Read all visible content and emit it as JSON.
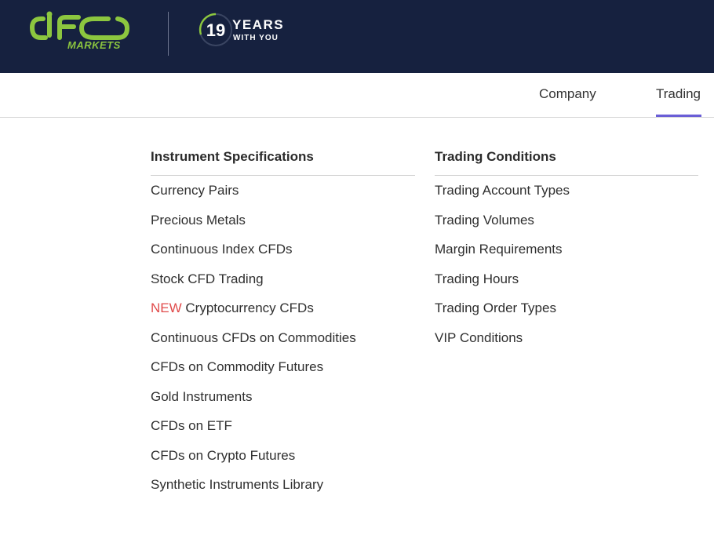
{
  "header": {
    "logo_text": "IFC",
    "logo_subtext": "MARKETS",
    "years_number": "19",
    "years_label": "YEARS",
    "years_sublabel": "WITH YOU",
    "colors": {
      "background": "#16213f",
      "brand_green": "#8cc63f"
    }
  },
  "nav": {
    "items": [
      {
        "label": "Company"
      },
      {
        "label": "Trading",
        "active": true
      }
    ],
    "active_color": "#6a5ed6"
  },
  "menu": {
    "instrument_specifications": {
      "title": "Instrument Specifications",
      "items": [
        {
          "label": "Currency Pairs"
        },
        {
          "label": "Precious Metals"
        },
        {
          "label": "Continuous Index CFDs"
        },
        {
          "label": "Stock CFD Trading"
        },
        {
          "badge": "NEW",
          "label": "Cryptocurrency CFDs"
        },
        {
          "label": "Continuous CFDs on Commodities"
        },
        {
          "label": "CFDs on Commodity Futures"
        },
        {
          "label": "Gold Instruments"
        },
        {
          "label": "CFDs on ETF"
        },
        {
          "label": "CFDs on Crypto Futures"
        },
        {
          "label": "Synthetic Instruments Library"
        }
      ]
    },
    "trading_conditions": {
      "title": "Trading Conditions",
      "items": [
        {
          "label": "Trading Account Types"
        },
        {
          "label": "Trading Volumes"
        },
        {
          "label": "Margin Requirements"
        },
        {
          "label": "Trading Hours"
        },
        {
          "label": "Trading Order Types"
        },
        {
          "label": "VIP Conditions"
        }
      ]
    },
    "badge_color": "#e04a4a"
  }
}
